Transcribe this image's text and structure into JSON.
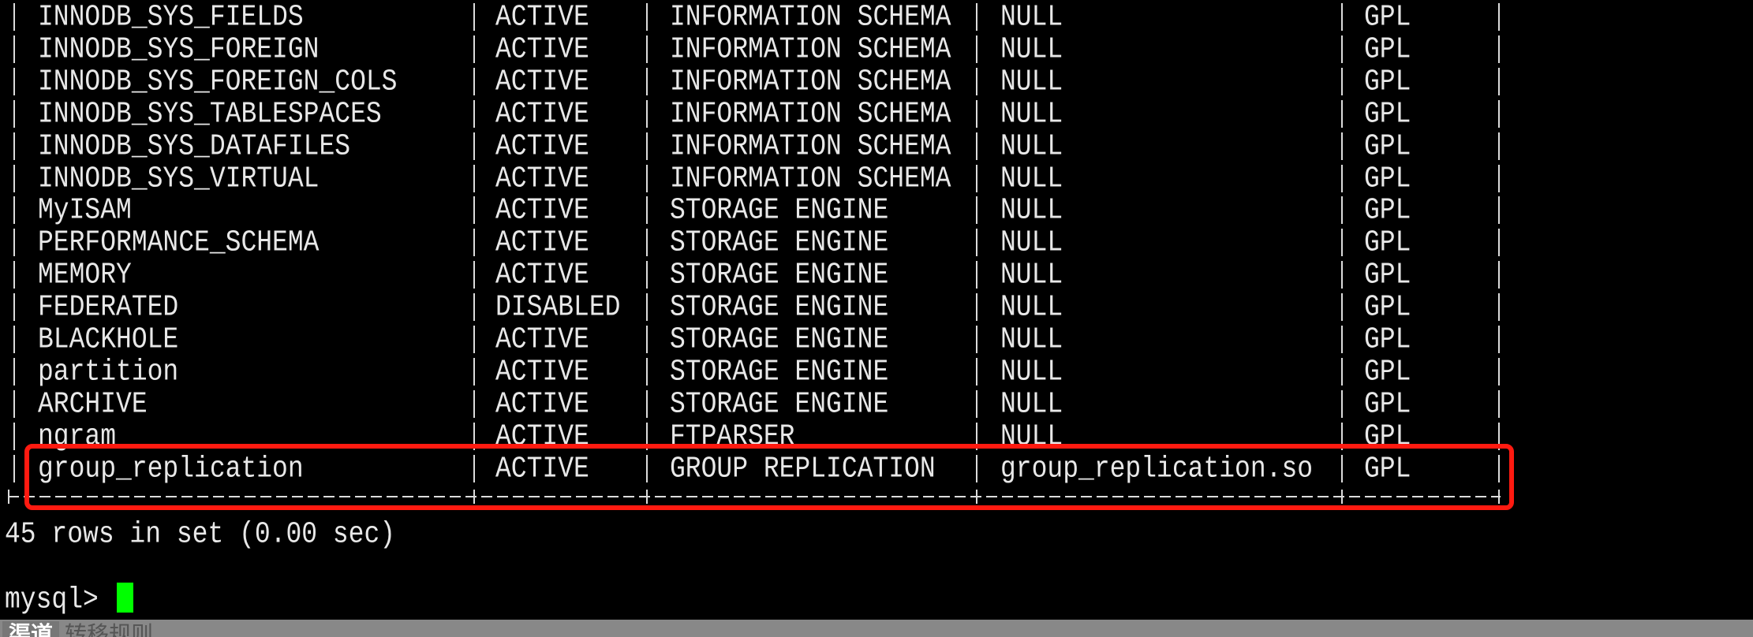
{
  "rows": [
    [
      "INNODB_SYS_FIELDS",
      "ACTIVE",
      "INFORMATION SCHEMA",
      "NULL",
      "GPL"
    ],
    [
      "INNODB_SYS_FOREIGN",
      "ACTIVE",
      "INFORMATION SCHEMA",
      "NULL",
      "GPL"
    ],
    [
      "INNODB_SYS_FOREIGN_COLS",
      "ACTIVE",
      "INFORMATION SCHEMA",
      "NULL",
      "GPL"
    ],
    [
      "INNODB_SYS_TABLESPACES",
      "ACTIVE",
      "INFORMATION SCHEMA",
      "NULL",
      "GPL"
    ],
    [
      "INNODB_SYS_DATAFILES",
      "ACTIVE",
      "INFORMATION SCHEMA",
      "NULL",
      "GPL"
    ],
    [
      "INNODB_SYS_VIRTUAL",
      "ACTIVE",
      "INFORMATION SCHEMA",
      "NULL",
      "GPL"
    ],
    [
      "MyISAM",
      "ACTIVE",
      "STORAGE ENGINE",
      "NULL",
      "GPL"
    ],
    [
      "PERFORMANCE_SCHEMA",
      "ACTIVE",
      "STORAGE ENGINE",
      "NULL",
      "GPL"
    ],
    [
      "MEMORY",
      "ACTIVE",
      "STORAGE ENGINE",
      "NULL",
      "GPL"
    ],
    [
      "FEDERATED",
      "DISABLED",
      "STORAGE ENGINE",
      "NULL",
      "GPL"
    ],
    [
      "BLACKHOLE",
      "ACTIVE",
      "STORAGE ENGINE",
      "NULL",
      "GPL"
    ],
    [
      "partition",
      "ACTIVE",
      "STORAGE ENGINE",
      "NULL",
      "GPL"
    ],
    [
      "ARCHIVE",
      "ACTIVE",
      "STORAGE ENGINE",
      "NULL",
      "GPL"
    ],
    [
      "ngram",
      "ACTIVE",
      "FTPARSER",
      "NULL",
      "GPL"
    ],
    [
      "group_replication",
      "ACTIVE",
      "GROUP REPLICATION",
      "group_replication.so",
      "GPL"
    ]
  ],
  "result_message": "45 rows in set (0.00 sec)",
  "prompt": "mysql> ",
  "highlight_color": "#ff1a10",
  "cursor_color": "#00ff00",
  "bottom_bar": {
    "active_tab": "渠道",
    "tab": "转移规则"
  }
}
